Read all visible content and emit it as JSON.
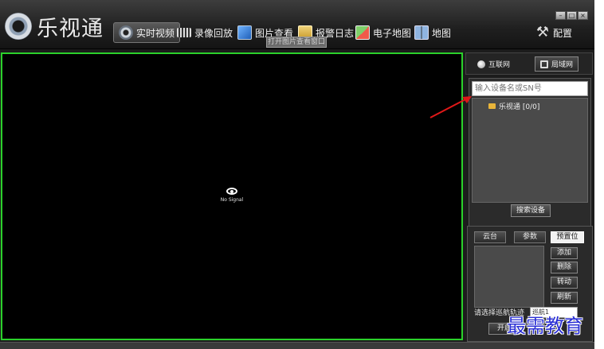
{
  "app": {
    "title": "乐视通"
  },
  "nav": {
    "items": [
      {
        "label": "实时视频",
        "icon": "camera-icon"
      },
      {
        "label": "录像回放",
        "icon": "film-icon"
      },
      {
        "label": "图片查看",
        "icon": "picture-icon"
      },
      {
        "label": "报警日志",
        "icon": "clipboard-icon"
      },
      {
        "label": "电子地图",
        "icon": "map-pin-icon"
      },
      {
        "label": "地图",
        "icon": "map-book-icon"
      }
    ],
    "config_label": "配置",
    "tooltip": "打开图片查看窗口"
  },
  "video": {
    "no_signal": "No Signal"
  },
  "network": {
    "internet_label": "互联网",
    "lan_label": "局域网"
  },
  "device": {
    "search_placeholder": "输入设备名或SN号",
    "tree_root": "乐视通 [0/0]",
    "search_button": "搜索设备"
  },
  "ptz": {
    "tabs": [
      "云台",
      "参数",
      "预置位"
    ],
    "actions": [
      "添加",
      "删除",
      "转动",
      "刷新"
    ],
    "cruise_label": "请选择巡航轨迹",
    "cruise_value": "巡航1",
    "start_label": "开启"
  },
  "watermark": "最需教育"
}
